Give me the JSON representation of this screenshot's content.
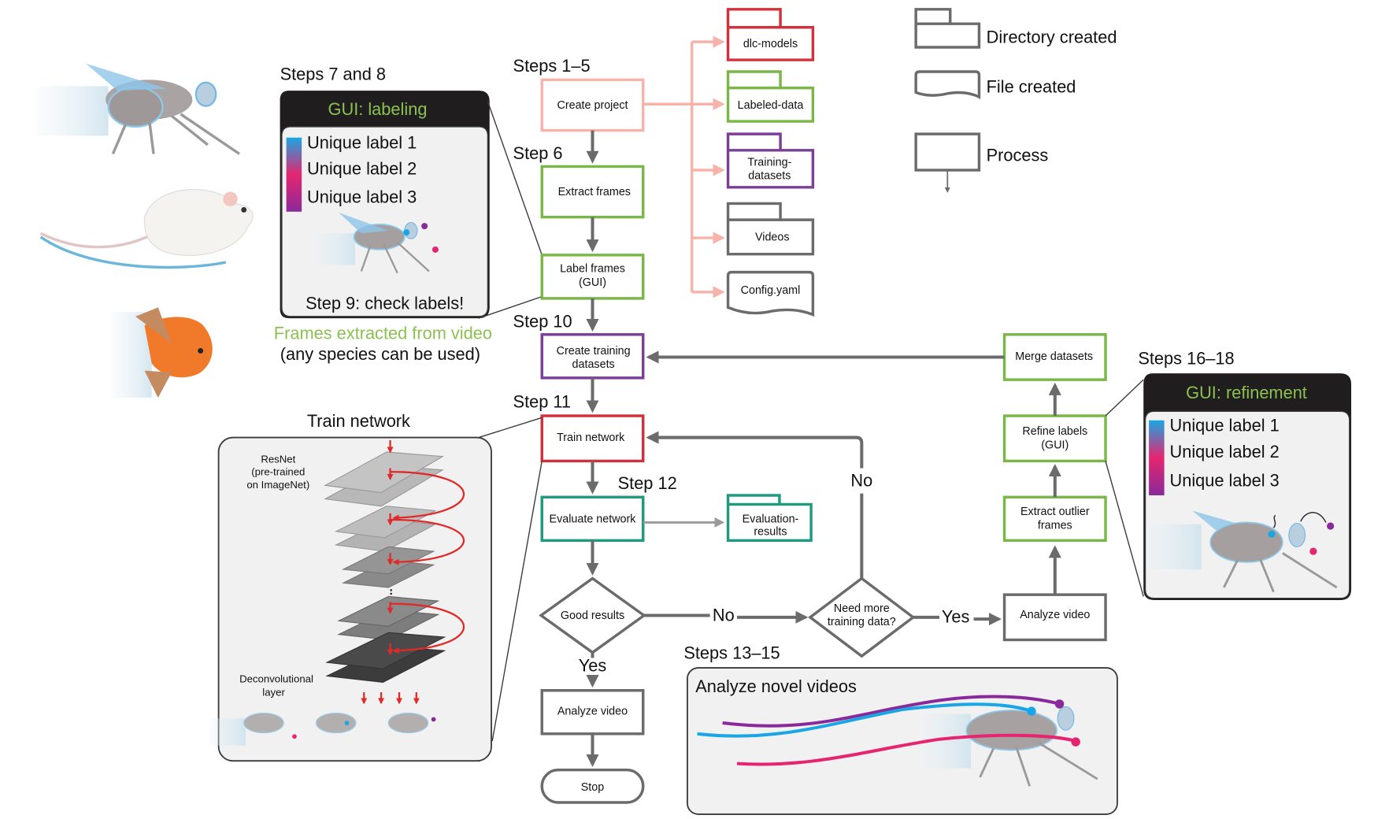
{
  "colors": {
    "create_project": "#f7b3aa",
    "green": "#7ab648",
    "purple": "#7b3f96",
    "red": "#d0313d",
    "teal": "#1f9a7e",
    "gray": "#6b6b6b",
    "gui_title": "#8cc152",
    "label1": "#1aa6e4",
    "label2": "#e5256f",
    "label3": "#8a2a9a"
  },
  "legend": {
    "directory": "Directory created",
    "file": "File created",
    "process": "Process"
  },
  "step_labels": {
    "s1_5": "Steps 1–5",
    "s6": "Step 6",
    "s7_8": "Steps 7 and 8",
    "s10": "Step 10",
    "s11": "Step 11",
    "s12": "Step 12",
    "s13_15": "Steps 13–15",
    "s16_18": "Steps 16–18"
  },
  "process_boxes": {
    "create_project": "Create project",
    "extract_frames": "Extract frames",
    "label_frames": [
      "Label frames",
      "(GUI)"
    ],
    "create_training": [
      "Create training",
      "datasets"
    ],
    "train_network": "Train network",
    "evaluate_network": "Evaluate network",
    "analyze_video_left": "Analyze video",
    "stop": "Stop",
    "merge_datasets": "Merge datasets",
    "refine_labels": [
      "Refine labels",
      "(GUI)"
    ],
    "extract_outlier": [
      "Extract outlier",
      "frames"
    ],
    "analyze_video_right": "Analyze video"
  },
  "decisions": {
    "good_results": "Good results",
    "need_more": [
      "Need more",
      "training data?"
    ]
  },
  "edge_labels": {
    "no1": "No",
    "no2": "No",
    "yes1": "Yes",
    "yes2": "Yes"
  },
  "directories": {
    "dlc_models": "dlc-models",
    "labeled_data": "Labeled-data",
    "training_datasets": [
      "Training-",
      "datasets"
    ],
    "videos": "Videos",
    "evaluation_results": [
      "Evaluation-",
      "results"
    ]
  },
  "files": {
    "config": "Config.yaml"
  },
  "gui_labeling": {
    "title": "GUI: labeling",
    "labels": [
      "Unique label 1",
      "Unique label 2",
      "Unique label 3"
    ],
    "footer": "Step 9: check labels!"
  },
  "frames_caption": {
    "line1": "Frames extracted from video",
    "line2": "(any species can be used)"
  },
  "train_panel": {
    "title": "Train network",
    "resnet": [
      "ResNet",
      "(pre-trained",
      "on ImageNet)"
    ],
    "deconv": [
      "Deconvolutional",
      "layer"
    ]
  },
  "gui_refinement": {
    "title": "GUI: refinement",
    "labels": [
      "Unique label 1",
      "Unique label 2",
      "Unique label 3"
    ]
  },
  "analyze_panel": {
    "title": "Analyze novel videos"
  },
  "species": [
    "fly",
    "mouse",
    "goldfish"
  ]
}
